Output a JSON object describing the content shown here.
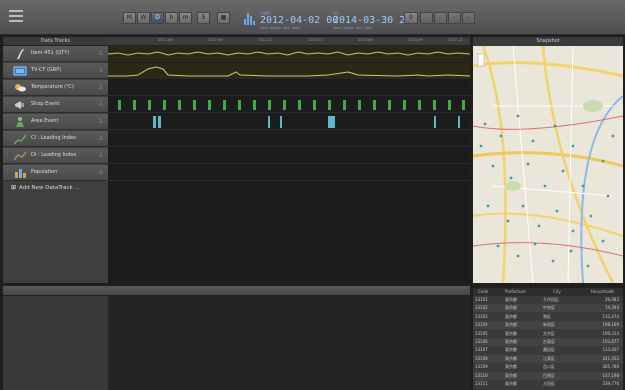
{
  "toolbar": {
    "buttons": [
      "M",
      "W",
      "D",
      "h",
      "m",
      "S"
    ],
    "range_from": {
      "label": "FROM",
      "date": "2012-04-02 00",
      "sub": "year month day hour"
    },
    "range_to": {
      "label": "TO",
      "date": "2014-03-30 23",
      "sub": "year month day hour"
    }
  },
  "tracks_header": "Data Tracks",
  "tracks": [
    {
      "label": "Item-451 (QTY)",
      "icon": "bottle-icon",
      "color": "#d8d8d8"
    },
    {
      "label": "TV-CF (GRP)",
      "icon": "tv-icon",
      "color": "#6fb0e8"
    },
    {
      "label": "Temperature (℃)",
      "icon": "weather-icon",
      "color": "#e0a040"
    },
    {
      "label": "Shop Event",
      "icon": "megaphone-icon",
      "color": "#c0c0c0"
    },
    {
      "label": "Area Event",
      "icon": "person-icon",
      "color": "#7ac070"
    },
    {
      "label": "CI : Leading Index",
      "icon": "chart-up-icon",
      "color": "#6aa860"
    },
    {
      "label": "DI : Leading Index",
      "icon": "chart-line-icon",
      "color": "#a88860"
    },
    {
      "label": "Population",
      "icon": "population-icon",
      "color": "#e0a040"
    }
  ],
  "add_track_label": "Add New DataTrack ...",
  "ruler_labels": [
    "2012-06",
    "2012-09",
    "2012-12",
    "2013-03",
    "2013-06",
    "2013-09",
    "2013-12",
    "2014-03"
  ],
  "snapshot_header": "Snapshot",
  "table": {
    "headers": [
      "Code",
      "Prefecture",
      "City",
      "Households"
    ],
    "rows": [
      [
        "13101",
        "東京都",
        "千代田区",
        "26,083"
      ],
      [
        "13102",
        "東京都",
        "中央区",
        "74,293"
      ],
      [
        "13103",
        "東京都",
        "港区",
        "132,474"
      ],
      [
        "13104",
        "東京都",
        "新宿区",
        "198,169"
      ],
      [
        "13105",
        "東京都",
        "文京区",
        "109,314"
      ],
      [
        "13106",
        "東京都",
        "台東区",
        "103,877"
      ],
      [
        "13107",
        "東京都",
        "墨田区",
        "133,607"
      ],
      [
        "13108",
        "東京都",
        "江東区",
        "241,052"
      ],
      [
        "13109",
        "東京都",
        "品川区",
        "205,786"
      ],
      [
        "13110",
        "東京都",
        "目黒区",
        "147,198"
      ],
      [
        "13111",
        "東京都",
        "大田区",
        "339,776"
      ]
    ]
  },
  "colors": {
    "accent": "#9cc8ff",
    "event_green": "#4fb04a",
    "event_teal": "#5fc0d0",
    "line_yellow": "#c8b86a"
  }
}
